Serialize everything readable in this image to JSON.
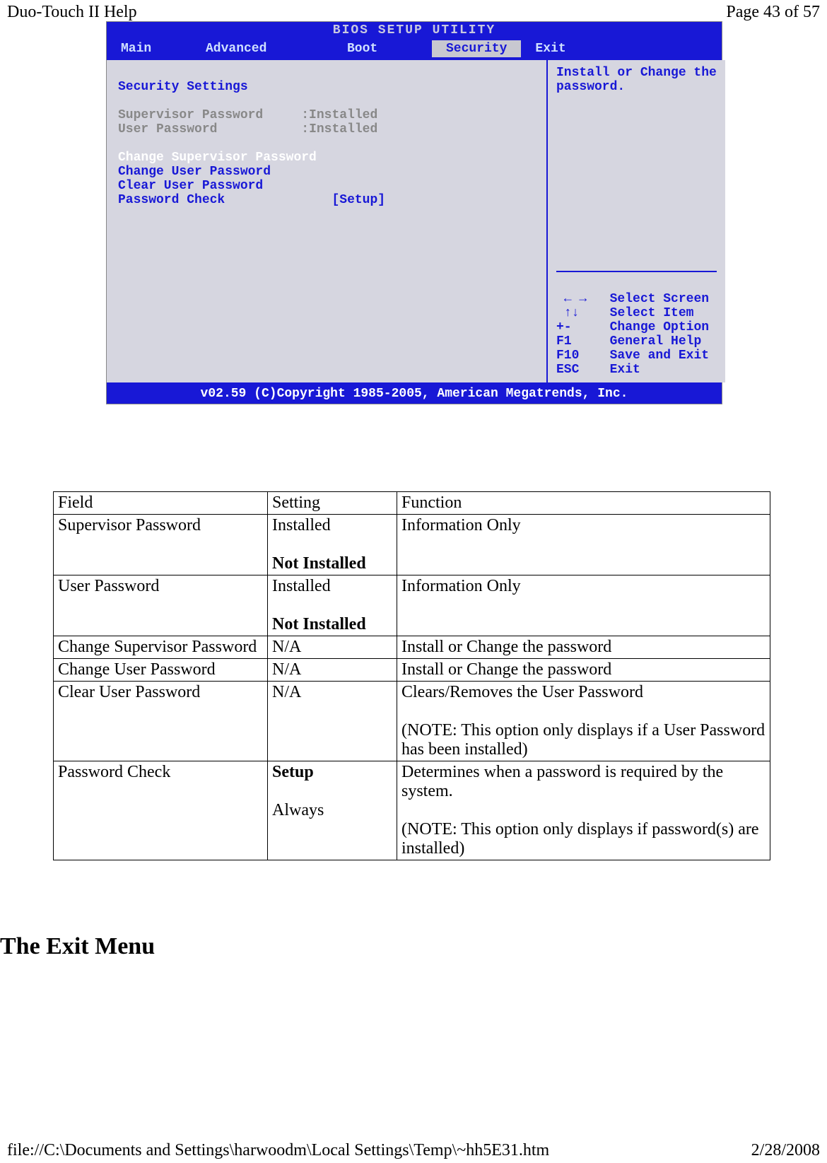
{
  "header": {
    "left": "Duo-Touch II Help",
    "right": "Page 43 of 57"
  },
  "footer": {
    "left": "file://C:\\Documents and Settings\\harwoodm\\Local Settings\\Temp\\~hh5E31.htm",
    "right": "2/28/2008"
  },
  "bios": {
    "title": "BIOS SETUP UTILITY",
    "tabs": {
      "main": "Main",
      "advanced": "Advanced",
      "boot": "Boot",
      "security": "Security",
      "exit": "Exit"
    },
    "left_col": {
      "heading": "Security Settings",
      "sp_label": "Supervisor Password",
      "sp_value": ":Installed",
      "up_label": "User Password",
      "up_value": ":Installed",
      "csp": "Change Supervisor Password",
      "cup": "Change User Password",
      "clu": "Clear User Password",
      "pc_label": "Password Check",
      "pc_value": "[Setup]"
    },
    "right_col": {
      "help1": "Install or Change the",
      "help2": "password.",
      "nav1l": "← →",
      "nav1r": "Select Screen",
      "nav2l": "↑↓",
      "nav2r": "Select Item",
      "nav3l": "+-",
      "nav3r": "Change Option",
      "nav4l": "F1",
      "nav4r": "General Help",
      "nav5l": "F10",
      "nav5r": "Save and Exit",
      "nav6l": "ESC",
      "nav6r": "Exit"
    },
    "footer": "v02.59 (C)Copyright 1985-2005, American Megatrends, Inc."
  },
  "table": {
    "h1": "Field",
    "h2": "Setting",
    "h3": "Function",
    "r1c1": "Supervisor Password",
    "r1c2a": "Installed",
    "r1c2b": "Not Installed",
    "r1c3": "Information Only",
    "r2c1": "User Password",
    "r2c2a": "Installed",
    "r2c2b": "Not Installed",
    "r2c3": "Information Only",
    "r3c1": "Change Supervisor Password",
    "r3c2": "N/A",
    "r3c3": "Install or Change the password",
    "r4c1": "Change User Password",
    "r4c2": "N/A",
    "r4c3": "Install or Change the password",
    "r5c1": "Clear  User Password",
    "r5c2": "N/A",
    "r5c3a": "Clears/Removes the User Password",
    "r5c3b": "(NOTE: This option only displays if a User Password has been installed)",
    "r6c1": "Password Check",
    "r6c2a": "Setup",
    "r6c2b": "Always",
    "r6c3a": "Determines when a password is required by the system.",
    "r6c3b": "(NOTE: This option only displays if password(s) are installed)"
  },
  "heading": "The Exit Menu"
}
